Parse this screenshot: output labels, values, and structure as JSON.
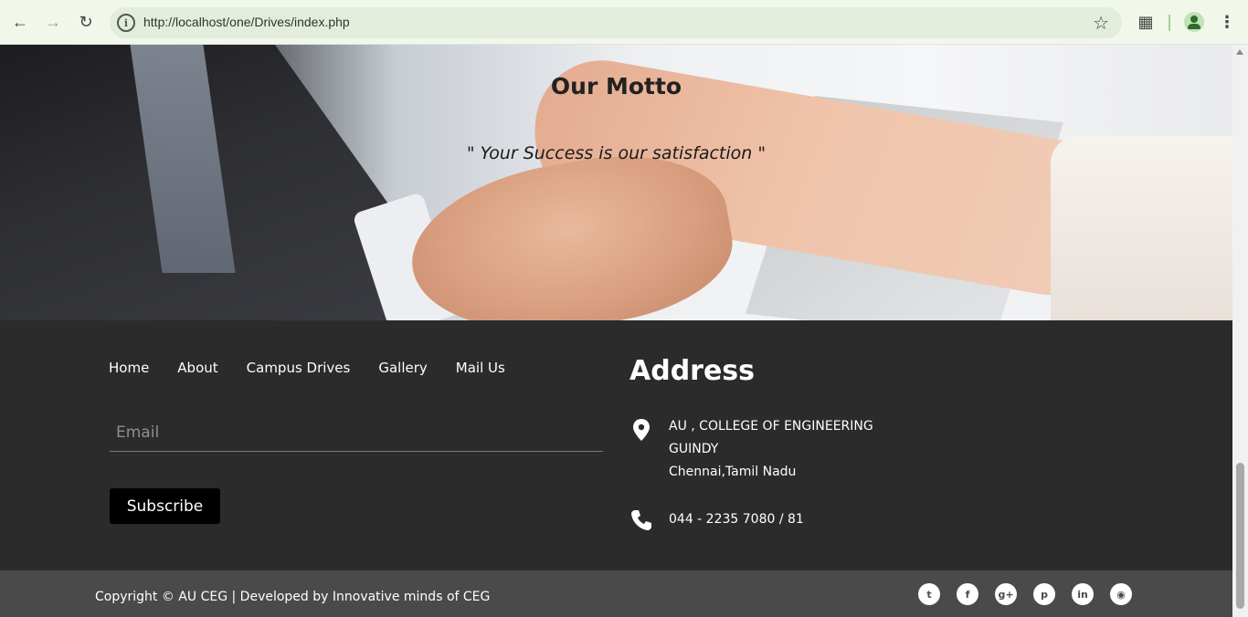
{
  "browser": {
    "url": "http://localhost/one/Drives/index.php",
    "icons": [
      "back-arrow-icon",
      "forward-arrow-icon",
      "reload-icon",
      "site-info-icon",
      "bookmark-star-icon",
      "extensions-icon",
      "profile-avatar-icon",
      "more-menu-icon"
    ]
  },
  "hero": {
    "title": "Our Motto",
    "motto": "\" Your Success is our satisfaction \""
  },
  "footer": {
    "nav": [
      "Home",
      "About",
      "Campus Drives",
      "Gallery",
      "Mail Us"
    ],
    "email_placeholder": "Email",
    "subscribe_label": "Subscribe",
    "address_title": "Address",
    "address_lines": [
      "AU , COLLEGE OF ENGINEERING",
      "GUINDY",
      "Chennai,Tamil Nadu"
    ],
    "phone": "044 - 2235 7080 / 81",
    "copyright": "Copyright © AU CEG | Developed by Innovative minds of CEG",
    "socials": [
      "twitter-icon",
      "facebook-icon",
      "google-plus-icon",
      "pinterest-icon",
      "linkedin-icon",
      "dribbble-icon"
    ]
  }
}
